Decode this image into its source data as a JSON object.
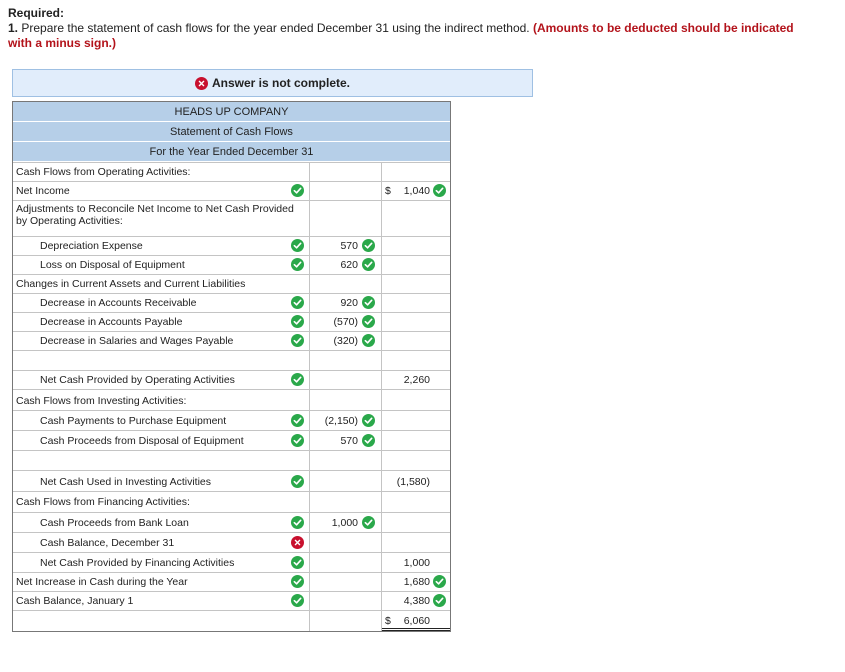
{
  "required": {
    "title": "Required:",
    "num": "1.",
    "text": " Prepare the statement of cash flows for the year ended December 31 using the indirect method. ",
    "warning": "(Amounts to be deducted should be indicated with a minus sign.)"
  },
  "banner": {
    "text": "Answer is not complete."
  },
  "header": {
    "company": "HEADS UP COMPANY",
    "statement": "Statement of Cash Flows",
    "period": "For the Year Ended December 31"
  },
  "rows": {
    "r1": {
      "label": "Cash Flows from Operating Activities:"
    },
    "r2": {
      "label": "Net Income",
      "c2": "1,040",
      "dollar": "$"
    },
    "r3": {
      "label": "Adjustments to Reconcile Net Income to Net Cash Provided by Operating Activities:"
    },
    "r4": {
      "label": "Depreciation Expense",
      "c1": "570"
    },
    "r5": {
      "label": "Loss on Disposal of Equipment",
      "c1": "620"
    },
    "r6": {
      "label": "Changes in Current Assets and Current Liabilities"
    },
    "r7": {
      "label": "Decrease in Accounts Receivable",
      "c1": "920"
    },
    "r8": {
      "label": "Decrease in Accounts Payable",
      "c1": "(570)"
    },
    "r9": {
      "label": "Decrease in Salaries and Wages Payable",
      "c1": "(320)"
    },
    "r10": {
      "label": ""
    },
    "r11": {
      "label": "Net Cash Provided by Operating Activities",
      "c2": "2,260"
    },
    "r12": {
      "label": "Cash Flows from Investing Activities:"
    },
    "r13": {
      "label": "Cash Payments to Purchase Equipment",
      "c1": "(2,150)"
    },
    "r14": {
      "label": "Cash Proceeds from Disposal of Equipment",
      "c1": "570"
    },
    "r15": {
      "label": ""
    },
    "r16": {
      "label": "Net Cash Used in Investing Activities",
      "c2": "(1,580)"
    },
    "r17": {
      "label": "Cash Flows from Financing Activities:"
    },
    "r18": {
      "label": "Cash Proceeds from Bank Loan",
      "c1": "1,000"
    },
    "r19": {
      "label": "Cash Balance, December 31"
    },
    "r20": {
      "label": "Net Cash Provided by Financing Activities",
      "c2": "1,000"
    },
    "r21": {
      "label": "Net Increase in Cash during the Year",
      "c2": "1,680"
    },
    "r22": {
      "label": "Cash Balance, January 1",
      "c2": "4,380"
    },
    "r23": {
      "label": "",
      "c2": "6,060",
      "dollar": "$"
    }
  },
  "colors": {
    "header_bg": "#b6cfe8",
    "banner_bg": "#e1edfb",
    "correct": "#2aa84a",
    "incorrect": "#c8102e",
    "warning_text": "#b3131b"
  },
  "icons": {
    "correct": "check-circle-icon",
    "incorrect": "x-circle-icon"
  }
}
